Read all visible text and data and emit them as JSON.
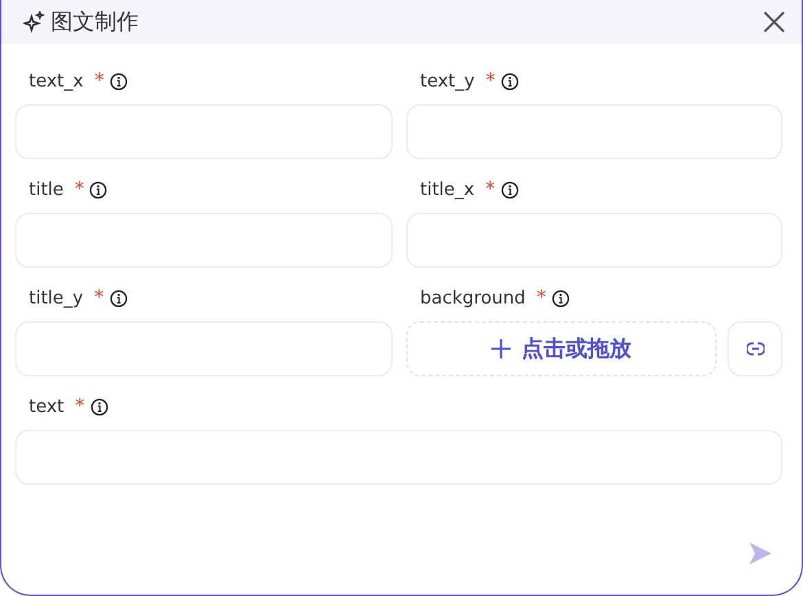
{
  "dialog": {
    "title": "图文制作"
  },
  "fields": [
    {
      "label": "text_x",
      "required_mark": "*",
      "kind": "input"
    },
    {
      "label": "text_y",
      "required_mark": "*",
      "kind": "input"
    },
    {
      "label": "title",
      "required_mark": "*",
      "kind": "input"
    },
    {
      "label": "title_x",
      "required_mark": "*",
      "kind": "input"
    },
    {
      "label": "title_y",
      "required_mark": "*",
      "kind": "input"
    },
    {
      "label": "background",
      "required_mark": "*",
      "kind": "upload",
      "upload_text": "点击或拖放"
    },
    {
      "label": "text",
      "required_mark": "*",
      "kind": "input",
      "wide": true
    }
  ]
}
